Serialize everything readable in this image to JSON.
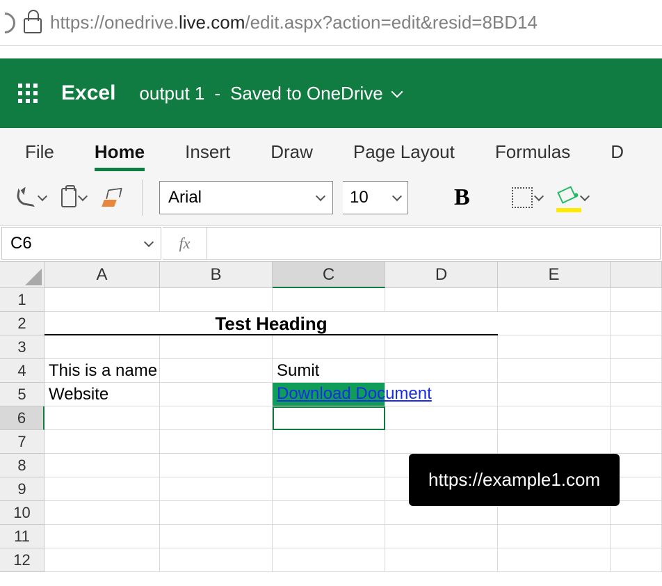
{
  "address_bar": {
    "url_prefix_gray": "https://onedrive.",
    "url_dark": "live.com",
    "url_suffix_gray": "/edit.aspx?action=edit&resid=8BD14"
  },
  "header": {
    "app_name": "Excel",
    "doc_name": "output 1",
    "save_status": "Saved to OneDrive"
  },
  "tabs": {
    "items": [
      "File",
      "Home",
      "Insert",
      "Draw",
      "Page Layout",
      "Formulas",
      "D"
    ],
    "active_index": 1
  },
  "toolbar": {
    "font_name": "Arial",
    "font_size": "10"
  },
  "namebox": {
    "value": "C6"
  },
  "formula_bar": {
    "fx_label": "fx",
    "value": ""
  },
  "grid": {
    "columns": [
      "A",
      "B",
      "C",
      "D",
      "E"
    ],
    "active_col_index": 2,
    "rows": [
      "1",
      "2",
      "3",
      "4",
      "5",
      "6",
      "7",
      "8",
      "9",
      "10",
      "11",
      "12"
    ],
    "active_row_index": 5,
    "merged_heading": "Test Heading",
    "a4": "This is a name",
    "c4": "Sumit",
    "a5": "Website",
    "c5_link": "Download Document"
  },
  "tooltip": {
    "text": "https://example1.com"
  }
}
